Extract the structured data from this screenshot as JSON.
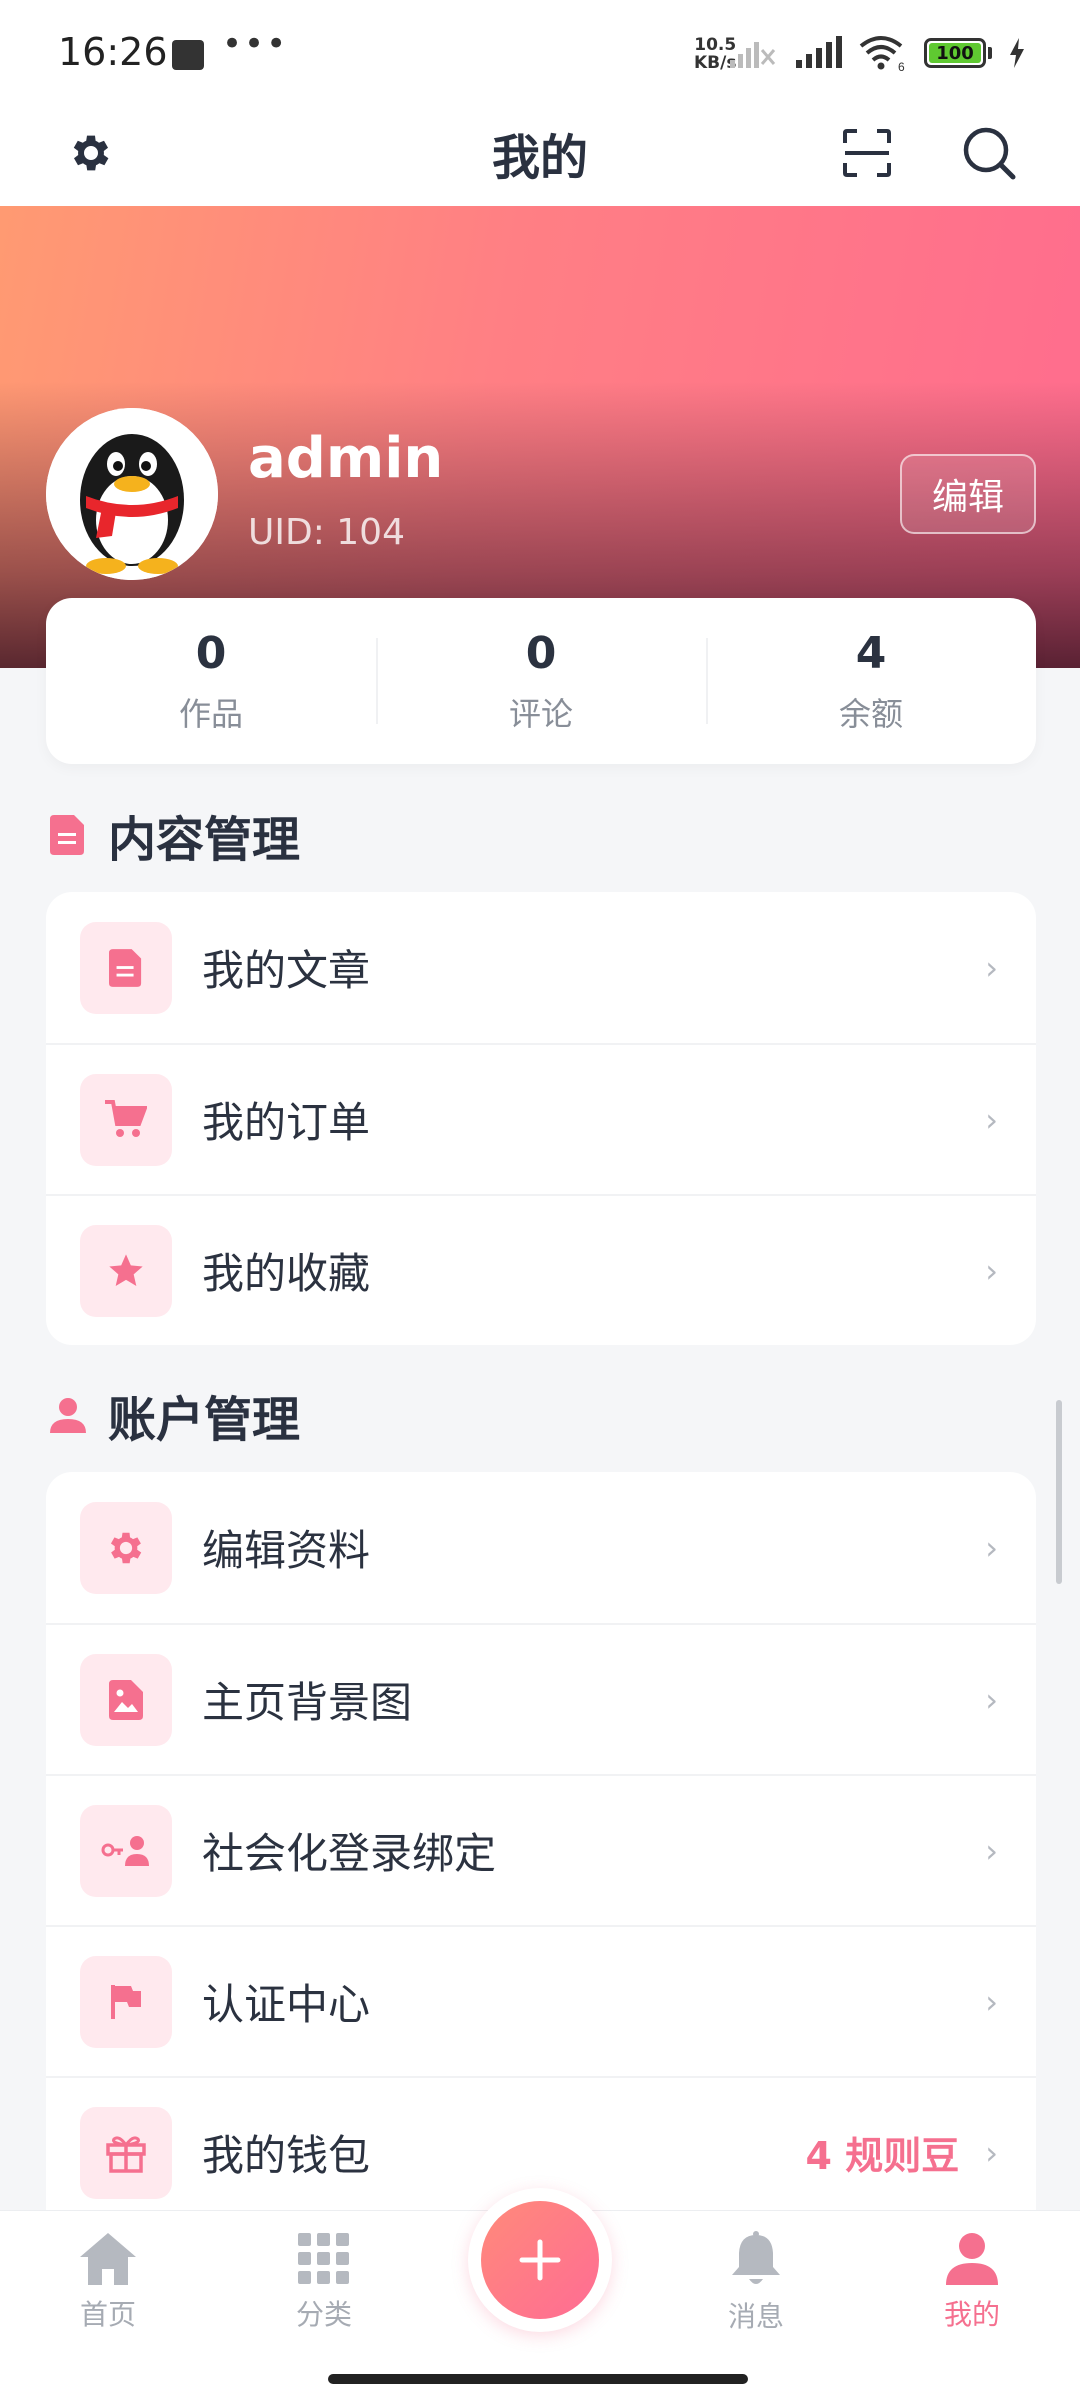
{
  "status": {
    "time": "16:26",
    "speed_value": "10.5",
    "speed_unit": "KB/s",
    "battery": "100",
    "wifi_badge": "6"
  },
  "header": {
    "title": "我的"
  },
  "profile": {
    "username": "admin",
    "uid": "UID: 104",
    "edit_label": "编辑"
  },
  "stats": [
    {
      "value": "0",
      "label": "作品"
    },
    {
      "value": "0",
      "label": "评论"
    },
    {
      "value": "4",
      "label": "余额"
    }
  ],
  "content_section": {
    "title": "内容管理",
    "items": [
      {
        "label": "我的文章",
        "icon": "document-icon"
      },
      {
        "label": "我的订单",
        "icon": "cart-icon"
      },
      {
        "label": "我的收藏",
        "icon": "star-icon"
      }
    ]
  },
  "account_section": {
    "title": "账户管理",
    "items": [
      {
        "label": "编辑资料",
        "icon": "gear-icon"
      },
      {
        "label": "主页背景图",
        "icon": "image-icon"
      },
      {
        "label": "社会化登录绑定",
        "icon": "key-user-icon"
      },
      {
        "label": "认证中心",
        "icon": "flag-icon"
      },
      {
        "label": "我的钱包",
        "icon": "gift-icon",
        "extra": "4 规则豆"
      }
    ]
  },
  "nav": {
    "items": [
      {
        "label": "首页",
        "icon": "home-icon"
      },
      {
        "label": "分类",
        "icon": "grid-icon"
      },
      {
        "label": "消息",
        "icon": "bell-icon"
      },
      {
        "label": "我的",
        "icon": "user-icon"
      }
    ],
    "active": "我的",
    "fab_icon": "plus-icon"
  },
  "colors": {
    "accent": "#f5708f",
    "hero_start": "#ff9a72",
    "hero_end": "#ff6c8e",
    "icon_bg": "#ffe9ee",
    "text": "#2b3240"
  }
}
